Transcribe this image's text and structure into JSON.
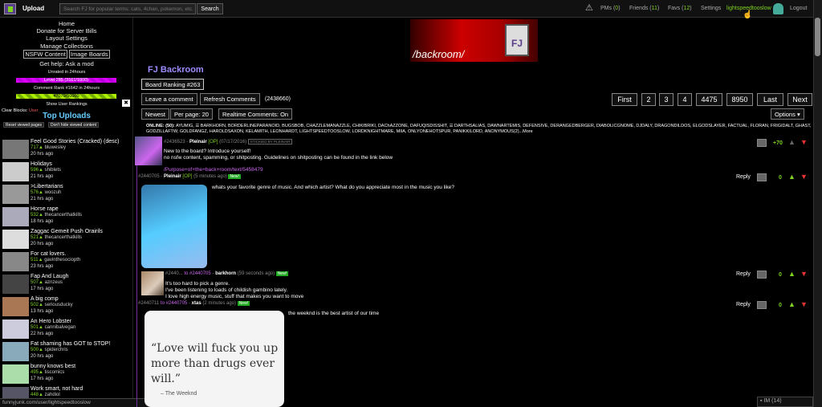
{
  "topbar": {
    "upload": "Upload",
    "search_placeholder": "Search FJ for popular terms: cats, 4chan, pokemon, etc.",
    "search_button": "Search",
    "pms_label": "PMs (",
    "pms_count": "0",
    "pms_end": ")",
    "friends_label": "Friends (",
    "friends_count": "11",
    "friends_end": ")",
    "favs_label": "Favs (",
    "favs_count": "12",
    "favs_end": ")",
    "settings": "Settings",
    "username": "lightspeedtooslow",
    "logout": "Logout"
  },
  "sidebar": {
    "links": [
      "Home",
      "Donate for Server Bills",
      "Layout Settings",
      "Manage Collections"
    ],
    "nsfw": "NSFW Content",
    "image_boards": "Image Boards",
    "help": "Get help: Ask a mod",
    "unrated": "Unrated in 24hours",
    "level_bar": "Level 285 (3161/1000)",
    "comment_rank": "Comment Rank #1642 in 24hours",
    "xp_bar": "47079/50000",
    "show_user_rankings": "Show User Rankings",
    "clear_blocks": "Clear Blocks:",
    "clear_user": "User",
    "reset_viewed": "Reset viewed pages",
    "dont_hide": "Don't hide viewed content",
    "top_uploads": "Top Uploads",
    "uploads": [
      {
        "title": "Feel Good Stories (Cracked) (desc)",
        "score": "717",
        "user": "bluwesley",
        "time": "20 hrs ago"
      },
      {
        "title": "Holidays",
        "score": "596",
        "user": "shiblets",
        "time": "21 hrs ago"
      },
      {
        "title": ">Libertarians",
        "score": "576",
        "user": "woozuh",
        "time": "21 hrs ago"
      },
      {
        "title": "Horse rape",
        "score": "532",
        "user": "thecancerthatkills",
        "time": "18 hrs ago"
      },
      {
        "title": "Zaggac Gemeit Push Orairils",
        "score": "521",
        "user": "thecancerthatkills",
        "time": "20 hrs ago"
      },
      {
        "title": "For cat lovers.",
        "score": "511",
        "user": "gavinthesociopth",
        "time": "23 hrs ago"
      },
      {
        "title": "Fap And Laugh",
        "score": "507",
        "user": "aznzeus",
        "time": "17 hrs ago"
      },
      {
        "title": "A big comp",
        "score": "502",
        "user": "seriousducky",
        "time": "13 hrs ago"
      },
      {
        "title": "An Hero Lobster",
        "score": "501",
        "user": "cannibalvegan",
        "time": "22 hrs ago"
      },
      {
        "title": "Fat shaming has GOT to STOP!",
        "score": "500",
        "user": "spiderchris",
        "time": "20 hrs ago"
      },
      {
        "title": "bunny knows best",
        "score": "495",
        "user": "tiscomics",
        "time": "17 hrs ago"
      },
      {
        "title": "Work smart, not hard",
        "score": "448",
        "user": "zahdiol",
        "time": "19 hrs ago"
      }
    ]
  },
  "status_url": "funnyjunk.com/user/lightspeedtooslow",
  "banner": {
    "text": "/backroom/"
  },
  "board": {
    "title": "FJ Backroom",
    "ranking": "Board Ranking #263",
    "leave_comment": "Leave a comment",
    "refresh": "Refresh Comments",
    "count": "(2438660)",
    "newest": "Newest",
    "per_page": "Per page: 20",
    "realtime": "Realtime Comments: On",
    "options": "Options",
    "pages": [
      "First",
      "2",
      "3",
      "4",
      "4475",
      "8950",
      "Last",
      "Next"
    ]
  },
  "online": {
    "label": "ONLINE: (50):",
    "names": "AYUMIG, ☰ BARKHORN, BORDERLINEPARANOID, BUGSBOB, CHAZZLEMANAZZLE, CHIKIBRIKI, DAChAZZONE, DAFUQISDISSHIT, ☰ DARTHSALIAS, DAWNARTEMIS, DEFENSIVE, DERANGEDBERGER, DIABOLICGNOME, DJDALY, DRAGONDILDOS, ELGODSLAYER, FACTUAL, FLORAN, FRIGIDALT, GHAST, GODZILLAFTW, GOLDFANGZ, HAROLDSAXON, KELAMITH, LEONHARDT, LIGHTSPEEDTOOSLOW, LORDKNIGHTMARE, MIIA, ONLYONEHOTSPUR, PANIKKILORD, ANONYMOUS(2)...More"
  },
  "comments": [
    {
      "id": "#2436523",
      "user": "Pleinair",
      "op": "[OP]",
      "date": "(07/17/2016)",
      "sticky": "STICKIED BY PLEINAIR",
      "lines": [
        "New to the board? Introduce yourself!",
        "no nsfw content, spamming, or shitposting. Guidelines on shitposting can be found in the link below"
      ],
      "link": "/Purpose+of+the+back+room/text/5458479",
      "score": "+70"
    },
    {
      "id": "#2440705",
      "user": "Pleinair",
      "op": "[OP]",
      "date": "(5 minutes ago)",
      "badge": "New!",
      "lines": [
        "whats your favorite genre of music. And which artist? What do you appreciate most in the music you like?"
      ],
      "score": "0",
      "reply": "Reply"
    },
    {
      "id": "#2440...",
      "to": "to #2440705",
      "user": "barkhorn",
      "date": "(59 seconds ago)",
      "badge": "New!",
      "lines": [
        "It's too hard to pick a genre.",
        "I've been listening to loads of childish gambino lately.",
        "I love high energy music, stuff that makes you want to move"
      ],
      "score": "0",
      "reply": "Reply"
    },
    {
      "id": "#2440711",
      "to": "to #2440705",
      "user": "xtas",
      "date": "(2 minutes ago)",
      "badge": "New!",
      "lines": [
        "the weeknd is the best artist of our time"
      ],
      "score": "0",
      "reply": "Reply",
      "quote": "“Love will fuck you up more than drugs ever will.”",
      "quote_author": "– The Weeknd"
    }
  ],
  "im": {
    "label": "IM (14)"
  }
}
